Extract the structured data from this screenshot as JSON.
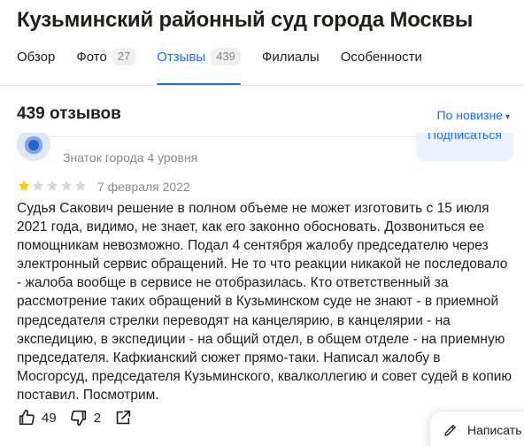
{
  "page": {
    "title": "Кузьминский районный суд города Москвы"
  },
  "tabs": [
    {
      "label": "Обзор",
      "count": ""
    },
    {
      "label": "Фото",
      "count": "27"
    },
    {
      "label": "Отзывы",
      "count": "439",
      "active": true
    },
    {
      "label": "Филиалы",
      "count": ""
    },
    {
      "label": "Особенности",
      "count": ""
    }
  ],
  "reviews": {
    "header": "439 отзывов",
    "sort_label": "По новизне",
    "sort_caret": "▾"
  },
  "review": {
    "author_level": "Знаток города 4 уровня",
    "subscribe_label": "Подписаться",
    "rating": 1,
    "rating_max": 5,
    "date": "7 февраля 2022",
    "text": "Судья Сакович решение в полном объеме не может изготовить с 15 июля 2021 года, видимо, не знает, как его законно обосновать. Дозвониться ее помощникам невозможно. Подал 4 сентября жалобу председателю через электронный сервис обращений. Не то что реакции никакой не последовало - жалоба вообще в сервисе не отобразилась. Кто ответственный за рассмотрение таких обращений в Кузьминском суде не знают - в приемной председателя стрелки переводят на канцелярию, в канцелярии - на экспедицию, в экспедиции - на общий отдел, в общем отделе - на приемную председателя. Кафкианский сюжет прямо-таки. Написал жалобу в Мосгорсуд, председателя Кузьминского, квалколлегию и совет судей в копию поставил. Посмотрим.",
    "likes": "49",
    "dislikes": "2"
  },
  "write_button": {
    "label": "Написать"
  },
  "colors": {
    "accent": "#196dff",
    "star_filled": "#fc0",
    "star_empty": "#d9d9d9",
    "muted": "#8a8a8a"
  },
  "icons": {
    "like": "thumbs-up-icon",
    "dislike": "thumbs-down-icon",
    "share": "share-icon",
    "write": "pencil-icon"
  }
}
